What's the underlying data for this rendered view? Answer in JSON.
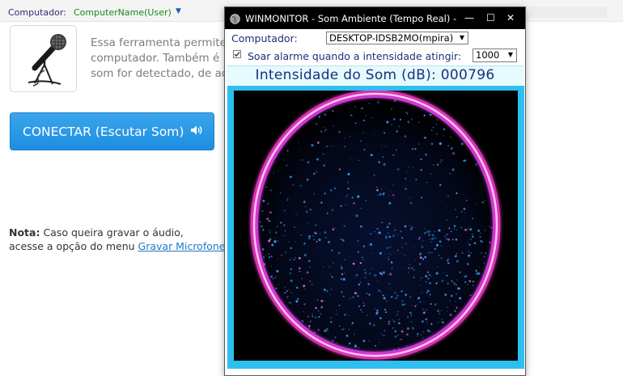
{
  "topbar": {
    "label": "Computador:",
    "value": "ComputerName(User)",
    "caret": "▼"
  },
  "tool": {
    "desc_lines": [
      "Essa ferramenta permite",
      "computador. Também é",
      "som for detectado, de ac"
    ],
    "connect_label": "CONECTAR (Escutar Som)",
    "speaker_icon": "🔊"
  },
  "note": {
    "bold": "Nota:",
    "line1": " Caso queira gravar o áudio,",
    "line2": "acesse a opção do menu ",
    "link": "Gravar Microfone",
    "period": "."
  },
  "window": {
    "title": "WINMONITOR - Som Ambiente (Tempo Real) -...",
    "minimize": "—",
    "maximize": "☐",
    "close": "✕",
    "computer_label": "Computador:",
    "computer_value": "DESKTOP-IDSB2MO(mpira)",
    "alarm_label": "Soar alarme quando a intensidade atingir:",
    "alarm_checked": true,
    "alarm_value": "1000",
    "intensity_label": "Intensidade do Som (dB): 000796",
    "colors": {
      "frame": "#2dbff0",
      "ring": "#ff3dd8",
      "particles": "#3aa2ff"
    }
  }
}
